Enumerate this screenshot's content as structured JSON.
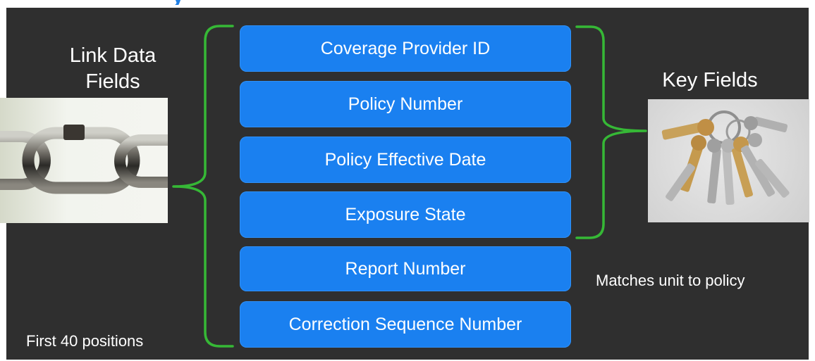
{
  "title": {
    "fragment": "y"
  },
  "left": {
    "heading_line1": "Link Data",
    "heading_line2": "Fields",
    "image_icon": "chain-link-icon",
    "caption": "First 40 positions"
  },
  "right": {
    "heading": "Key Fields",
    "image_icon": "keys-icon",
    "caption": "Matches unit to policy"
  },
  "fields": [
    {
      "label": "Coverage Provider ID"
    },
    {
      "label": "Policy Number"
    },
    {
      "label": "Policy Effective Date"
    },
    {
      "label": "Exposure State"
    },
    {
      "label": "Report Number"
    },
    {
      "label": "Correction Sequence Number"
    }
  ],
  "colors": {
    "background": "#2f2f2f",
    "field_box": "#1a80f0",
    "brace": "#36b836",
    "title": "#1f7fe6",
    "text": "#ffffff"
  }
}
